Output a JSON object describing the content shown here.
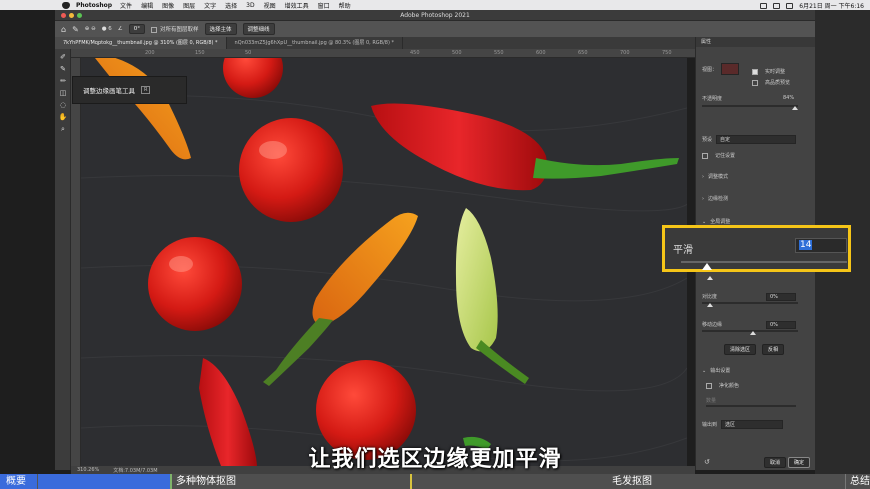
{
  "menubar": {
    "app": "Photoshop",
    "items": [
      "文件",
      "编辑",
      "图像",
      "图层",
      "文字",
      "选择",
      "3D",
      "视图",
      "增效工具",
      "窗口",
      "帮助"
    ],
    "clock": "6月21日 周一 下午6:16"
  },
  "window": {
    "title": "Adobe Photoshop 2021"
  },
  "options": {
    "angle": "0°",
    "sample_all": "对所有图层取样",
    "select_subject": "选择主体",
    "refine_hair": "调整细线"
  },
  "tabs": [
    {
      "label": "7kYhPFMK/Mqptokg__thumbnail.jpg @ 310% (图层 0, RGB/8) *"
    },
    {
      "label": "nQn033mZ5Jg6hXpU__thumbnail.jpg @ 80.3% (图层 0, RGB/8) *"
    }
  ],
  "ruler_top": [
    "250",
    "200",
    "150",
    "100",
    "50",
    "400",
    "350",
    "450",
    "500",
    "550",
    "600",
    "650",
    "700",
    "750",
    "800",
    "850"
  ],
  "ruler_left": [
    "50",
    "100",
    "150",
    "200",
    "250",
    "300",
    "350",
    "400",
    "450",
    "500",
    "550"
  ],
  "popup": {
    "label": "调整边缘画笔工具",
    "key": "R"
  },
  "status": {
    "zoom": "310.26%",
    "doc": "文档:7.03M/7.03M"
  },
  "panel": {
    "title": "属性",
    "view_label": "视图：",
    "live_adjust": "实时调整",
    "high_quality": "高品质预览",
    "opacity_label": "不透明度",
    "opacity_value": "84%",
    "preset_label": "预设",
    "preset_value": "自定",
    "remember": "记住设置",
    "sections": {
      "mode": "调整模式",
      "edge": "边缘检测",
      "global": "全局调整",
      "output": "输出设置"
    },
    "contrast_label": "对比度",
    "contrast_value": "0%",
    "shift_label": "移动边缘",
    "shift_value": "0%",
    "clear_btn": "清除选区",
    "invert_btn": "反相",
    "decontaminate": "净化颜色",
    "amount_label": "数量",
    "output_to_label": "输出到",
    "output_to_value": "选区",
    "cancel": "取消",
    "ok": "确定"
  },
  "highlight": {
    "label": "平滑",
    "value": "14"
  },
  "subtitle": "让我们选区边缘更加平滑",
  "chapters": [
    "概要",
    "",
    "多种物体抠图",
    "毛发抠图",
    "总结"
  ],
  "colors": {
    "accent": "#f5c518",
    "chapter_blue": "#3a6bdc",
    "selected_text": "#2e6fd8"
  }
}
